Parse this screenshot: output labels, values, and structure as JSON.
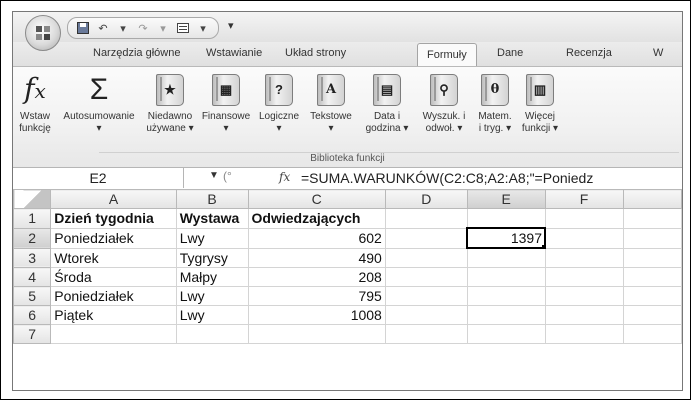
{
  "quick_access": {
    "more": "▾"
  },
  "tabs": [
    {
      "label": "Narzędzia główne"
    },
    {
      "label": "Wstawianie"
    },
    {
      "label": "Układ strony"
    },
    {
      "label": "Formuły"
    },
    {
      "label": "Dane"
    },
    {
      "label": "Recenzja"
    },
    {
      "label": "W"
    }
  ],
  "ribbon": {
    "buttons": [
      {
        "label": "Wstaw\nfunkcję",
        "icon": "fx-icon"
      },
      {
        "label": "Autosumowanie\n▾",
        "icon": "sigma-icon"
      },
      {
        "label": "Niedawno\nużywane ▾",
        "icon": "recent-book-icon"
      },
      {
        "label": "Finansowe\n▾",
        "icon": "financial-book-icon"
      },
      {
        "label": "Logiczne\n▾",
        "icon": "logical-book-icon"
      },
      {
        "label": "Tekstowe\n▾",
        "icon": "text-book-icon"
      },
      {
        "label": "Data i\ngodzina ▾",
        "icon": "date-book-icon"
      },
      {
        "label": "Wyszuk. i\nodwoł. ▾",
        "icon": "lookup-book-icon"
      },
      {
        "label": "Matem.\ni tryg. ▾",
        "icon": "math-book-icon"
      },
      {
        "label": "Więcej\nfunkcji ▾",
        "icon": "more-books-icon"
      }
    ],
    "group_label": "Biblioteka funkcji"
  },
  "formula_bar": {
    "name_box": "E2",
    "fx": "fx",
    "formula": "=SUMA.WARUNKÓW(C2:C8;A2:A8;\"=Poniedz"
  },
  "sheet": {
    "columns": [
      "A",
      "B",
      "C",
      "D",
      "E",
      "F",
      ""
    ],
    "rows": [
      {
        "num": "1",
        "cells": [
          "Dzień tygodnia",
          "Wystawa",
          "Odwiedzających",
          "",
          "",
          "",
          ""
        ]
      },
      {
        "num": "2",
        "cells": [
          "Poniedziałek",
          "Lwy",
          "602",
          "",
          "1397",
          "",
          ""
        ]
      },
      {
        "num": "3",
        "cells": [
          "Wtorek",
          "Tygrysy",
          "490",
          "",
          "",
          "",
          ""
        ]
      },
      {
        "num": "4",
        "cells": [
          "Środa",
          "Małpy",
          "208",
          "",
          "",
          "",
          ""
        ]
      },
      {
        "num": "5",
        "cells": [
          "Poniedziałek",
          "Lwy",
          "795",
          "",
          "",
          "",
          ""
        ]
      },
      {
        "num": "6",
        "cells": [
          "Piątek",
          "Lwy",
          "1008",
          "",
          "",
          "",
          ""
        ]
      },
      {
        "num": "7",
        "cells": [
          "",
          "",
          "",
          "",
          "",
          "",
          ""
        ]
      }
    ],
    "active_cell": "E2"
  }
}
